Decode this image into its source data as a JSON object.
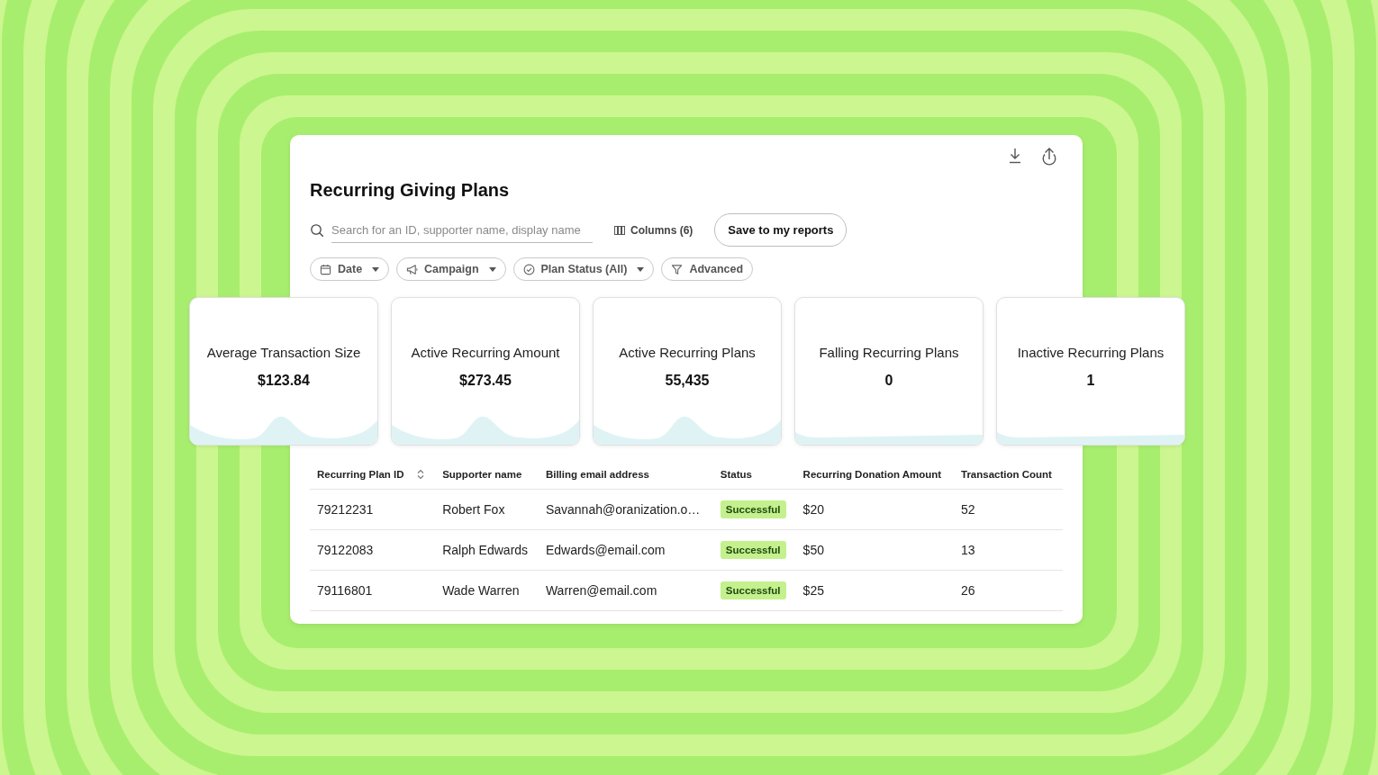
{
  "report": {
    "title": "Recurring Giving Plans"
  },
  "search": {
    "placeholder": "Search for an ID, supporter name, display name"
  },
  "columns_button": {
    "label": "Columns (6)"
  },
  "save_button": {
    "label": "Save to my reports"
  },
  "filters": [
    {
      "kind": "date",
      "label": "Date",
      "dropdown": true
    },
    {
      "kind": "campaign",
      "label": "Campaign",
      "dropdown": true
    },
    {
      "kind": "status",
      "label": "Plan Status (All)",
      "dropdown": true
    },
    {
      "kind": "advanced",
      "label": "Advanced",
      "dropdown": false
    }
  ],
  "cards": [
    {
      "kind": "peak",
      "title": "Average Transaction Size",
      "value": "$123.84"
    },
    {
      "kind": "peak",
      "title": "Active Recurring Amount",
      "value": "$273.45"
    },
    {
      "kind": "peak",
      "title": "Active Recurring Plans",
      "value": "55,435"
    },
    {
      "kind": "flat",
      "title": "Falling Recurring Plans",
      "value": "0"
    },
    {
      "kind": "flat",
      "title": "Inactive Recurring Plans",
      "value": "1"
    }
  ],
  "table": {
    "columns": [
      {
        "label": "Recurring Plan ID",
        "sortable": true
      },
      {
        "label": "Supporter name",
        "sortable": false
      },
      {
        "label": "Billing email address",
        "sortable": false
      },
      {
        "label": "Status",
        "sortable": false
      },
      {
        "label": "Recurring Donation Amount",
        "sortable": false
      },
      {
        "label": "Transaction Count",
        "sortable": false
      }
    ],
    "rows": [
      {
        "plan_id": "79212231",
        "supporter_name": "Robert Fox",
        "billing_email": "Savannah@oranization.o…",
        "status": "Successful",
        "amount": "$20",
        "transaction_count": "52"
      },
      {
        "plan_id": "79122083",
        "supporter_name": "Ralph Edwards",
        "billing_email": "Edwards@email.com",
        "status": "Successful",
        "amount": "$50",
        "transaction_count": "13"
      },
      {
        "plan_id": "79116801",
        "supporter_name": "Wade Warren",
        "billing_email": "Warren@email.com",
        "status": "Successful",
        "amount": "$25",
        "transaction_count": "26"
      }
    ]
  }
}
